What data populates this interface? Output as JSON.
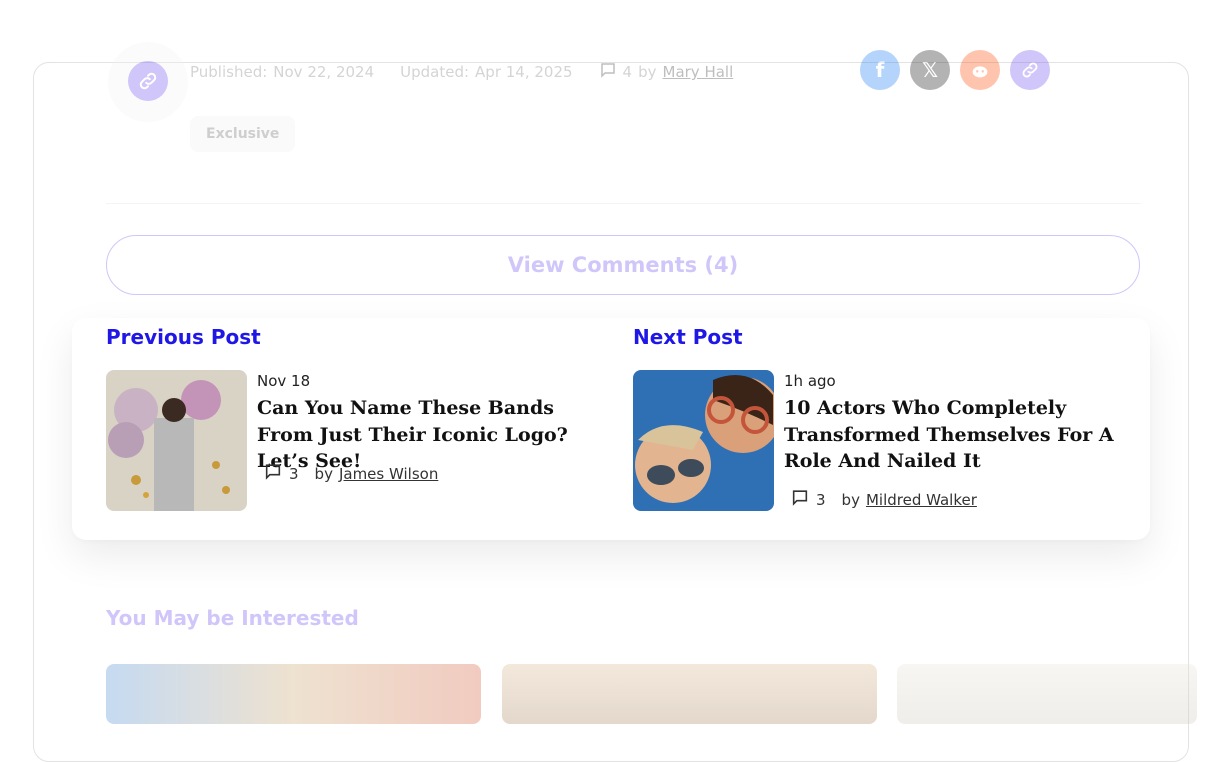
{
  "article_meta": {
    "published_label": "Published:",
    "published_date": "Nov 22, 2024",
    "updated_label": "Updated:",
    "updated_date": "Apr 14, 2025",
    "comment_count": "4",
    "by": "by",
    "author": "Mary Hall",
    "tag": "Exclusive"
  },
  "share": {
    "icons": [
      "facebook-icon",
      "x-icon",
      "reddit-icon",
      "link-icon"
    ],
    "colors": [
      "#1877f2",
      "#111111",
      "#ff4500",
      "#6b4ef0"
    ]
  },
  "comments_button": "View Comments (4)",
  "previous_post": {
    "heading": "Previous Post",
    "date": "Nov 18",
    "title": "Can You Name These Bands From Just Their Iconic Logo? Let’s See!",
    "comment_count": "3",
    "by": "by",
    "author": "James Wilson"
  },
  "next_post": {
    "heading": "Next Post",
    "date": "1h ago",
    "title": "10 Actors Who Completely Transformed Themselves For A Role And Nailed It",
    "comment_count": "3",
    "by": "by",
    "author": "Mildred Walker"
  },
  "related": {
    "heading": "You May be Interested"
  },
  "colors": {
    "accent": "#6b4ef0",
    "nav_heading": "#1f17e6"
  }
}
